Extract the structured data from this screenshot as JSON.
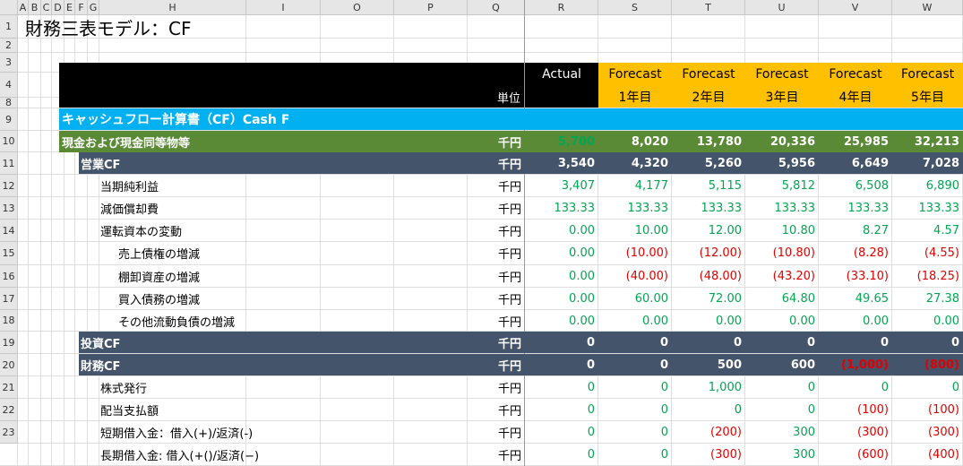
{
  "spreadsheet": {
    "columns": [
      "A",
      "B",
      "C",
      "D",
      "E",
      "F",
      "G",
      "H",
      "I",
      "O",
      "P",
      "Q",
      "R",
      "S",
      "T",
      "U",
      "V",
      "W"
    ],
    "rows": [
      "1",
      "2",
      "3",
      "4",
      "8",
      "9",
      "10",
      "11",
      "12",
      "13",
      "14",
      "15",
      "16",
      "17",
      "18",
      "19",
      "20",
      "21",
      "22",
      "23"
    ],
    "title": "財務三表モデル：CF",
    "unit_header": "単位",
    "header": {
      "actual": "Actual",
      "forecast": [
        "Forecast",
        "Forecast",
        "Forecast",
        "Forecast",
        "Forecast"
      ],
      "years": [
        "1年目",
        "2年目",
        "3年目",
        "4年目",
        "5年目"
      ]
    },
    "section_title": "キャッシュフロー計算書（CF）Cash F",
    "lines": [
      {
        "label": "現金および現金同等物等",
        "unit": "千円",
        "values": [
          "5,700",
          "8,020",
          "13,780",
          "20,336",
          "25,985",
          "32,213"
        ]
      },
      {
        "label": "営業CF",
        "unit": "千円",
        "values": [
          "3,540",
          "4,320",
          "5,260",
          "5,956",
          "6,649",
          "7,028"
        ]
      },
      {
        "label": "当期純利益",
        "unit": "千円",
        "values": [
          "3,407",
          "4,177",
          "5,115",
          "5,812",
          "6,508",
          "6,890"
        ]
      },
      {
        "label": "減価償却費",
        "unit": "千円",
        "values": [
          "133.33",
          "133.33",
          "133.33",
          "133.33",
          "133.33",
          "133.33"
        ]
      },
      {
        "label": "運転資本の変動",
        "unit": "千円",
        "values": [
          "0.00",
          "10.00",
          "12.00",
          "10.80",
          "8.27",
          "4.57"
        ]
      },
      {
        "label": "売上債権の増減",
        "unit": "千円",
        "values": [
          "0.00",
          "(10.00)",
          "(12.00)",
          "(10.80)",
          "(8.28)",
          "(4.55)"
        ]
      },
      {
        "label": "棚卸資産の増減",
        "unit": "千円",
        "values": [
          "0.00",
          "(40.00)",
          "(48.00)",
          "(43.20)",
          "(33.10)",
          "(18.25)"
        ]
      },
      {
        "label": "買入債務の増減",
        "unit": "千円",
        "values": [
          "0.00",
          "60.00",
          "72.00",
          "64.80",
          "49.65",
          "27.38"
        ]
      },
      {
        "label": "その他流動負債の増減",
        "unit": "千円",
        "values": [
          "0.00",
          "0.00",
          "0.00",
          "0.00",
          "0.00",
          "0.00"
        ]
      },
      {
        "label": "投資CF",
        "unit": "千円",
        "values": [
          "0",
          "0",
          "0",
          "0",
          "0",
          "0"
        ]
      },
      {
        "label": "財務CF",
        "unit": "千円",
        "values": [
          "0",
          "0",
          "500",
          "600",
          "(1,000)",
          "(800)"
        ]
      },
      {
        "label": "株式発行",
        "unit": "千円",
        "values": [
          "0",
          "0",
          "1,000",
          "0",
          "0",
          "0"
        ]
      },
      {
        "label": "配当支払額",
        "unit": "千円",
        "values": [
          "0",
          "0",
          "0",
          "0",
          "(100)",
          "(100)"
        ]
      },
      {
        "label": "短期借入金：借入(+)/返済(-)",
        "unit": "千円",
        "values": [
          "0",
          "0",
          "(200)",
          "300",
          "(300)",
          "(300)"
        ]
      },
      {
        "label": "長期借入金: 借入(+()/返済(−)",
        "unit": "千円",
        "values": [
          "0",
          "0",
          "(300)",
          "300",
          "(600)",
          "(400)"
        ]
      }
    ]
  },
  "colors": {
    "black_header": "#000000",
    "forecast_header": "#ffc000",
    "section_blue": "#00b0f0",
    "cash_green": "#5b8a36",
    "slate": "#44546a",
    "input_green": "#00a651",
    "negative_red": "#e00000"
  }
}
